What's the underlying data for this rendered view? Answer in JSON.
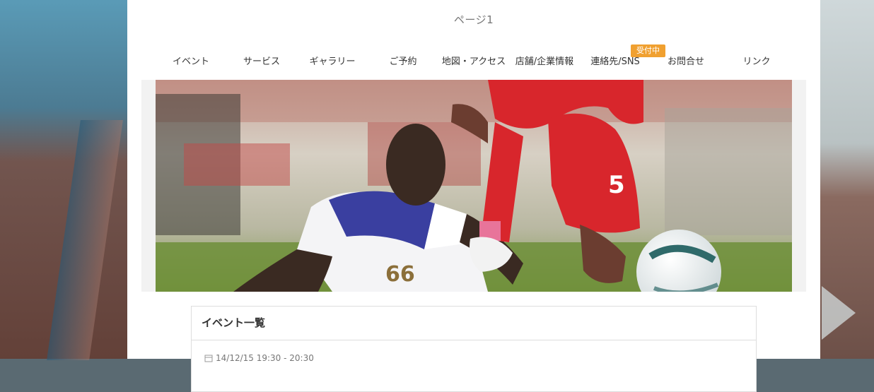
{
  "page": {
    "title": "ページ1"
  },
  "nav": {
    "items": [
      {
        "label": "イベント"
      },
      {
        "label": "サービス"
      },
      {
        "label": "ギャラリー"
      },
      {
        "label": "ご予約"
      },
      {
        "label": "地図・アクセス"
      },
      {
        "label": "店舗/企業情報"
      },
      {
        "label": "連絡先/SNS"
      },
      {
        "label": "お問合せ"
      },
      {
        "label": "リンク"
      }
    ]
  },
  "hero": {
    "image": "soccer-players-photo",
    "jersey_left": "66",
    "jersey_right": "5"
  },
  "events": {
    "heading": "イベント一覧",
    "first_item": {
      "date": "14/12/15 19:30 - 20:30",
      "status": "受付中"
    }
  },
  "colors": {
    "accent": "#f0a030",
    "red_kit": "#d8262c",
    "blue_kit": "#3a3fa0"
  }
}
